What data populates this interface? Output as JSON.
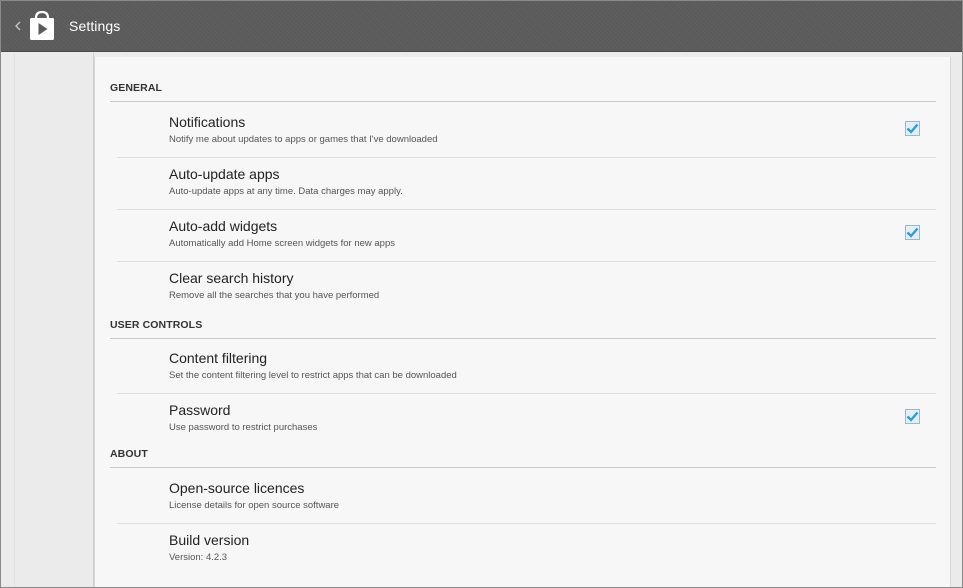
{
  "actionbar": {
    "up_icon": "chevron-left-icon",
    "app_icon": "play-store-icon",
    "title": "Settings"
  },
  "sections": {
    "general": {
      "header": "GENERAL",
      "items": [
        {
          "title": "Notifications",
          "subtitle": "Notify me about updates to apps or games that I've downloaded",
          "checked": true
        },
        {
          "title": "Auto-update apps",
          "subtitle": "Auto-update apps at any time. Data charges may apply.",
          "checked": null
        },
        {
          "title": "Auto-add widgets",
          "subtitle": "Automatically add Home screen widgets for new apps",
          "checked": true
        },
        {
          "title": "Clear search history",
          "subtitle": "Remove all the searches that you have performed",
          "checked": null
        }
      ]
    },
    "user_controls": {
      "header": "USER CONTROLS",
      "items": [
        {
          "title": "Content filtering",
          "subtitle": "Set the content filtering level to restrict apps that can be downloaded",
          "checked": null
        },
        {
          "title": "Password",
          "subtitle": "Use password to restrict purchases",
          "checked": true
        }
      ]
    },
    "about": {
      "header": "ABOUT",
      "items": [
        {
          "title": "Open-source licences",
          "subtitle": "License details for open source software",
          "checked": null
        },
        {
          "title": "Build version",
          "subtitle": "Version: 4.2.3",
          "checked": null
        }
      ]
    }
  },
  "colors": {
    "actionbar_bg": "#5a5a5a",
    "check_accent": "#33b5e5",
    "card_bg": "#f7f7f7"
  }
}
